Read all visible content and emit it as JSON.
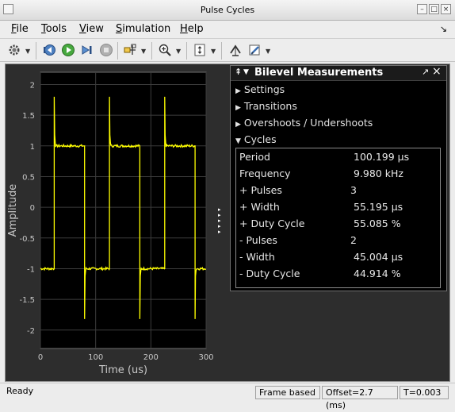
{
  "window": {
    "title": "Pulse Cycles"
  },
  "menu": {
    "items": [
      {
        "label": "File",
        "ul": "F",
        "rest": "ile"
      },
      {
        "label": "Tools",
        "ul": "T",
        "rest": "ools"
      },
      {
        "label": "View",
        "ul": "V",
        "rest": "iew"
      },
      {
        "label": "Simulation",
        "ul": "S",
        "rest": "imulation"
      },
      {
        "label": "Help",
        "ul": "H",
        "rest": "elp"
      }
    ]
  },
  "toolbar": {
    "icons": [
      "gear-icon",
      "step-back-icon",
      "run-icon",
      "step-forward-icon",
      "stop-icon",
      "trigger-icon",
      "zoom-in-icon",
      "scale-axes-icon",
      "cursor-measure-icon",
      "brush-edit-icon"
    ]
  },
  "panel": {
    "title": "Bilevel Measurements",
    "sections": [
      {
        "label": "Settings",
        "expanded": false
      },
      {
        "label": "Transitions",
        "expanded": false
      },
      {
        "label": "Overshoots / Undershoots",
        "expanded": false
      },
      {
        "label": "Cycles",
        "expanded": true
      }
    ],
    "cycles": [
      {
        "label": "Period",
        "value": "100.199 µs"
      },
      {
        "label": "Frequency",
        "value": "9.980 kHz"
      },
      {
        "label": "+ Pulses",
        "value": "3"
      },
      {
        "label": "+ Width",
        "value": "55.195 µs"
      },
      {
        "label": "+ Duty Cycle",
        "value": "55.085 %"
      },
      {
        "label": "- Pulses",
        "value": "2"
      },
      {
        "label": "- Width",
        "value": "45.004 µs"
      },
      {
        "label": "- Duty Cycle",
        "value": "44.914 %"
      }
    ]
  },
  "status": {
    "ready": "Ready",
    "frame": "Frame based",
    "offset": "Offset=2.7 (ms)",
    "time": "T=0.003"
  },
  "chart_data": {
    "type": "line",
    "xlabel": "Time (us)",
    "ylabel": "Amplitude",
    "xlim": [
      0,
      300
    ],
    "ylim": [
      -2.3,
      2.2
    ],
    "xticks": [
      0,
      100,
      200,
      300
    ],
    "yticks": [
      2,
      1.5,
      1,
      0.5,
      0,
      -0.5,
      -1,
      -1.5,
      -2
    ],
    "grid": true,
    "background": "#000000",
    "line_color": "#ffff00",
    "high_level": 1,
    "low_level": -1,
    "rising_edges_x": [
      25,
      125,
      225
    ],
    "falling_edges_x": [
      80,
      180,
      280
    ],
    "overshoot_peak": 1.8,
    "undershoot_peak": -1.82
  }
}
